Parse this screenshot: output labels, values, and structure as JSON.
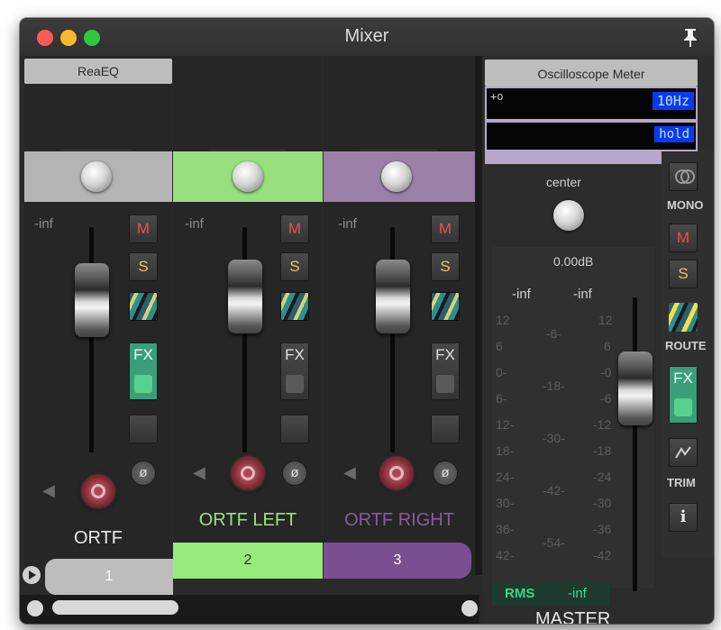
{
  "window": {
    "title": "Mixer"
  },
  "tracks": [
    {
      "fx": "ReaEQ",
      "volume": "-inf",
      "mute": "M",
      "solo": "S",
      "fx_label": "FX",
      "name": "ORTF",
      "number": "1",
      "color": "#bdbdbd",
      "name_color": "#e8e8e8"
    },
    {
      "fx": "",
      "volume": "-inf",
      "mute": "M",
      "solo": "S",
      "fx_label": "FX",
      "name": "ORTF LEFT",
      "number": "2",
      "color": "#98ea7c",
      "name_color": "#9be27d"
    },
    {
      "fx": "",
      "volume": "-inf",
      "mute": "M",
      "solo": "S",
      "fx_label": "FX",
      "name": "ORTF RIGHT",
      "number": "3",
      "color": "#7a4f8f",
      "name_color": "#8a5aa0"
    }
  ],
  "master": {
    "fx": "Oscilloscope Meter",
    "freq": "10Hz",
    "hold": "hold",
    "pan_label": "center",
    "gain": "0.00dB",
    "peak_l": "-inf",
    "peak_r": "-inf",
    "scale_outer": [
      "12",
      "6",
      "0-",
      "6-",
      "12-",
      "18-",
      "24-",
      "30-",
      "36-",
      "42-"
    ],
    "scale_outer_r": [
      "12",
      "6",
      "-0",
      "-6",
      "-12",
      "-18",
      "-24",
      "-30",
      "-36",
      "-42"
    ],
    "scale_mid": [
      "-6-",
      "-18-",
      "-30-",
      "-42-",
      "-54-"
    ],
    "rms_label": "RMS",
    "rms_value": "-inf",
    "name": "MASTER",
    "mono": "MONO",
    "mute": "M",
    "solo": "S",
    "route": "ROUTE",
    "fx_label": "FX",
    "trim": "TRIM",
    "info": "i"
  }
}
